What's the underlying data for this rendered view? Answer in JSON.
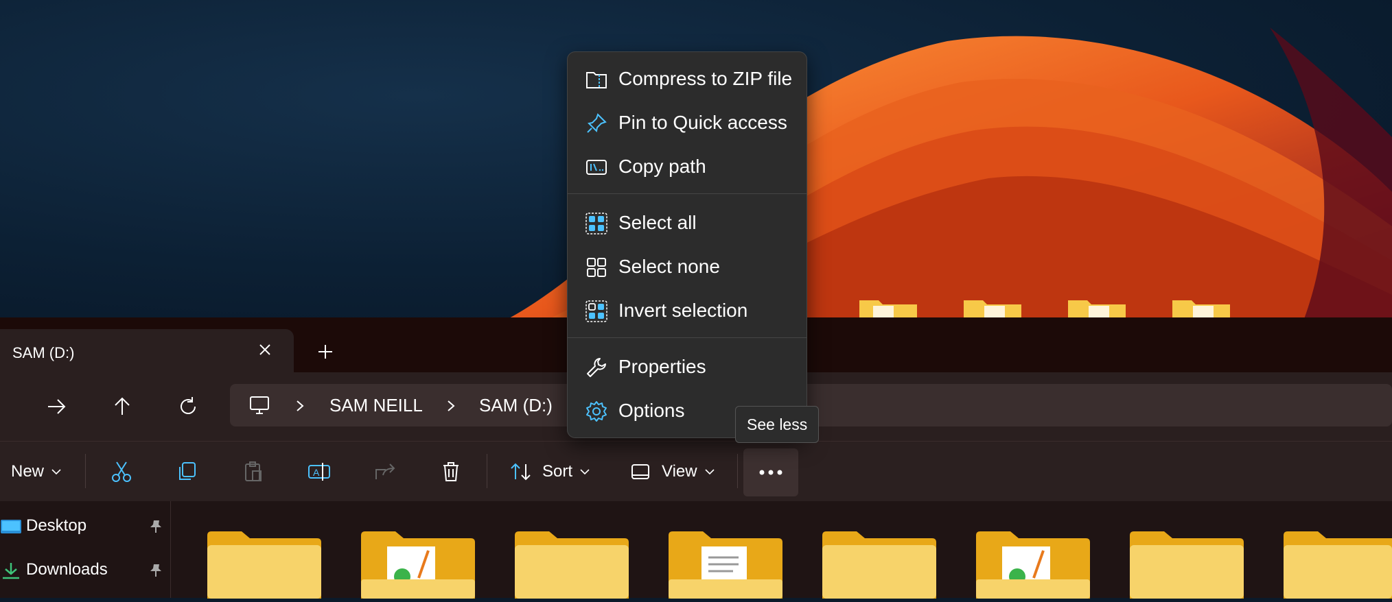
{
  "window": {
    "tab_title": "SAM (D:)"
  },
  "breadcrumb": {
    "items": [
      "SAM NEILL",
      "SAM (D:)"
    ]
  },
  "toolbar": {
    "new_label": "New",
    "sort_label": "Sort",
    "view_label": "View"
  },
  "sidebar": {
    "items": [
      {
        "label": "Desktop",
        "icon": "desktop-icon",
        "pinned": true
      },
      {
        "label": "Downloads",
        "icon": "download-icon",
        "pinned": true
      }
    ]
  },
  "context_menu": {
    "items": [
      {
        "label": "Compress to ZIP file",
        "icon": "zip-icon"
      },
      {
        "label": "Pin to Quick access",
        "icon": "pin-icon"
      },
      {
        "label": "Copy path",
        "icon": "copy-path-icon"
      },
      {
        "label": "Select all",
        "icon": "select-all-icon"
      },
      {
        "label": "Select none",
        "icon": "select-none-icon"
      },
      {
        "label": "Invert selection",
        "icon": "invert-selection-icon"
      },
      {
        "label": "Properties",
        "icon": "wrench-icon"
      },
      {
        "label": "Options",
        "icon": "gear-icon"
      }
    ]
  },
  "tooltip": {
    "text": "See less"
  },
  "colors": {
    "accent": "#4cc2ff",
    "folder": "#f7c948",
    "menu_bg": "#2c2c2c"
  }
}
